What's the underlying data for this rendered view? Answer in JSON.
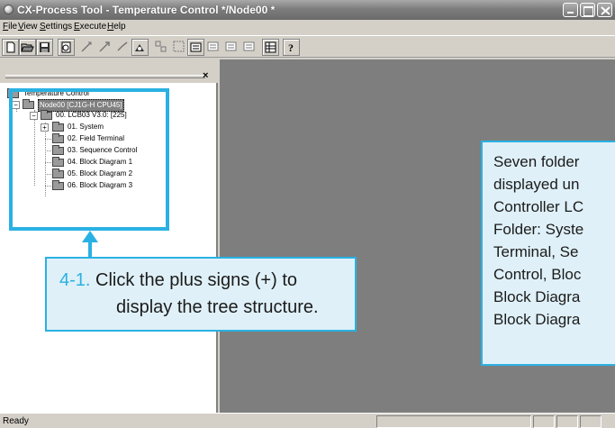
{
  "window": {
    "title": "CX-Process Tool - Temperature Control */Node00 *"
  },
  "menu": [
    {
      "label": "File",
      "hotkey": "F"
    },
    {
      "label": "View",
      "hotkey": "V"
    },
    {
      "label": "Settings",
      "hotkey": "S"
    },
    {
      "label": "Execute",
      "hotkey": "E"
    },
    {
      "label": "Help",
      "hotkey": "H"
    }
  ],
  "toolbar_icons": [
    "new-icon",
    "open-icon",
    "save-icon",
    "print-preview-icon",
    "wire-icon",
    "wire-arrow-icon",
    "wire-path-icon",
    "function-block-icon",
    "group-icon",
    "ungroup-icon",
    "block-list-icon",
    "step-icon",
    "connect-icon",
    "sequence-icon",
    "table-icon",
    "help-icon"
  ],
  "tree": {
    "root": "Temperature Control",
    "node": "Node00 [CJ1G-H CPU45]",
    "controller": "00. LCB03 V3.0: [225]",
    "folders": [
      "01. System",
      "02. Field Terminal",
      "03. Sequence Control",
      "04. Block Diagram 1",
      "05. Block Diagram 2",
      "06. Block Diagram 3"
    ],
    "pane_close": "×"
  },
  "callouts": {
    "plus": {
      "number": "4-1.",
      "line1": "Click the plus signs (+) to",
      "line2": "display the tree structure."
    },
    "seven": {
      "lines": [
        "Seven folder",
        "displayed un",
        "Controller LC",
        "Folder: Syste",
        "Terminal, Se",
        "Control, Bloc",
        "Block Diagra",
        "Block Diagra"
      ]
    }
  },
  "status": {
    "text": "Ready"
  },
  "colors": {
    "accent": "#2ab1e3",
    "callout_bg": "#dff0f8",
    "workspace": "#7e7e7e"
  }
}
